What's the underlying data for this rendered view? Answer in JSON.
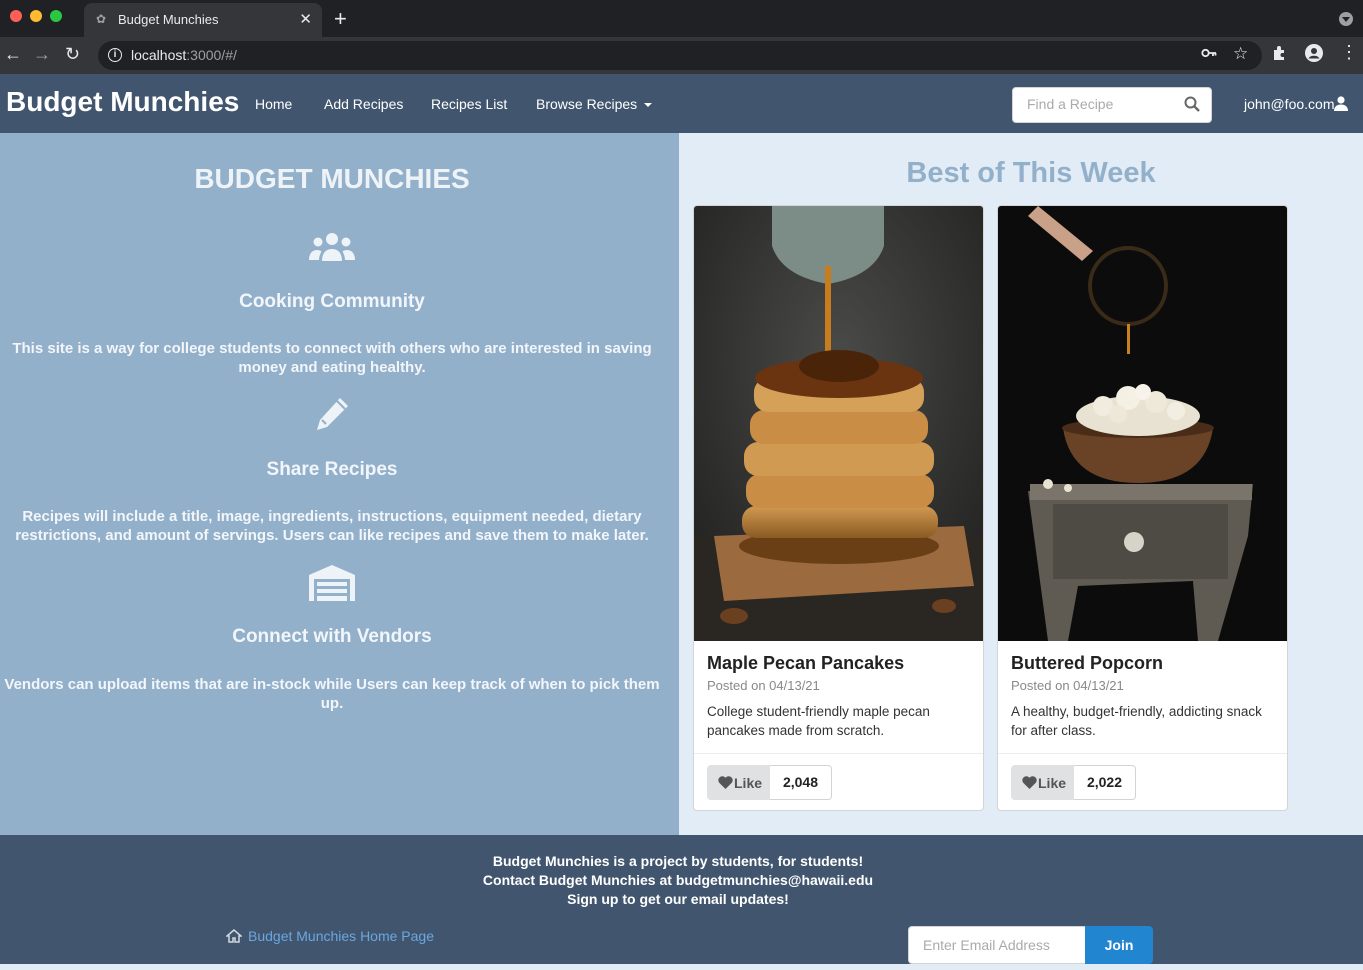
{
  "browser": {
    "tab_title": "Budget Munchies",
    "url_host": "localhost",
    "url_rest": ":3000/#/",
    "colors": {
      "close": "#ff5f57",
      "minimize": "#febc2e",
      "maximize": "#28c840"
    }
  },
  "nav": {
    "brand": "Budget Munchies",
    "links": [
      "Home",
      "Add Recipes",
      "Recipes List",
      "Browse Recipes"
    ],
    "search_placeholder": "Find a Recipe",
    "user": "john@foo.com"
  },
  "about": {
    "title": "BUDGET MUNCHIES",
    "features": [
      {
        "icon": "users-icon",
        "title": "Cooking Community",
        "text": "This site is a way for college students to connect with others who are interested in saving money and eating healthy."
      },
      {
        "icon": "pencil-icon",
        "title": "Share Recipes",
        "text": "Recipes will include a title, image, ingredients, instructions, equipment needed, dietary restrictions, and amount of servings. Users can like recipes and save them to make later."
      },
      {
        "icon": "warehouse-icon",
        "title": "Connect with Vendors",
        "text": "Vendors can upload items that are in-stock while Users can keep track of when to pick them up."
      }
    ]
  },
  "best": {
    "title": "Best of This Week",
    "cards": [
      {
        "name": "Maple Pecan Pancakes",
        "date": "Posted on 04/13/21",
        "description": "College student-friendly maple pecan pancakes made from scratch.",
        "like_label": "Like",
        "likes": "2,048"
      },
      {
        "name": "Buttered Popcorn",
        "date": "Posted on 04/13/21",
        "description": "A healthy, budget-friendly, addicting snack for after class.",
        "like_label": "Like",
        "likes": "2,022"
      }
    ]
  },
  "footer": {
    "lines": [
      "Budget Munchies is a project by students, for students!",
      "Contact Budget Munchies at budgetmunchies@hawaii.edu",
      "Sign up to get our email updates!"
    ],
    "home_link": "Budget Munchies Home Page",
    "email_placeholder": "Enter Email Address",
    "join_label": "Join"
  }
}
